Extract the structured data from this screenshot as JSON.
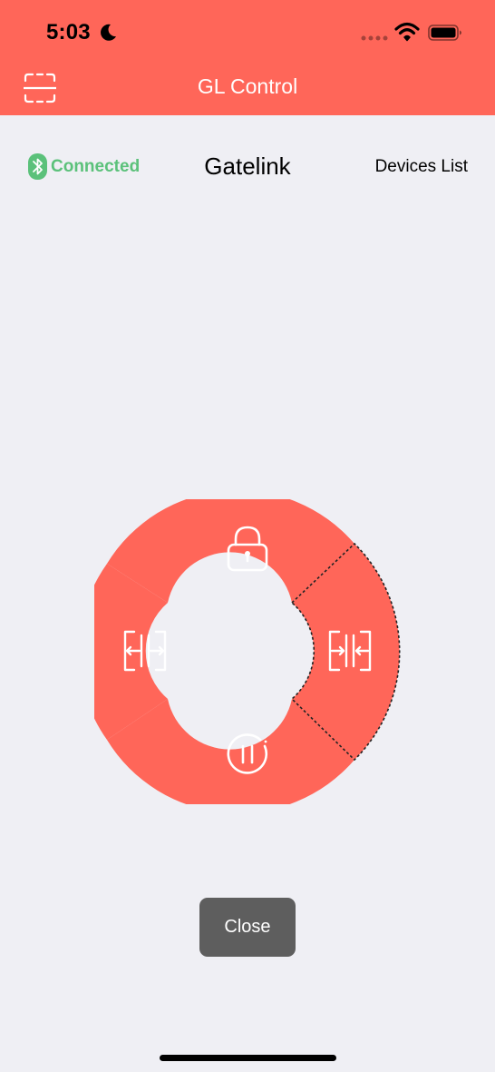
{
  "status_bar": {
    "time": "5:03",
    "icons": [
      "moon-icon",
      "signal-dots-icon",
      "wifi-icon",
      "battery-icon"
    ]
  },
  "header": {
    "title": "GL Control",
    "left_icon": "scan-icon"
  },
  "connection": {
    "icon": "bluetooth-icon",
    "status": "Connected",
    "device": "Gatelink",
    "devices_link": "Devices List"
  },
  "control_wheel": {
    "segments": [
      {
        "id": "lock",
        "icon": "lock-icon"
      },
      {
        "id": "open",
        "icon": "open-gate-icon"
      },
      {
        "id": "close",
        "icon": "close-gate-icon",
        "selected": true
      },
      {
        "id": "pause",
        "icon": "pause-icon"
      }
    ]
  },
  "close_button": "Close",
  "colors": {
    "accent": "#FF6659",
    "connected": "#5BC17A",
    "background": "#EFEFF4",
    "button": "#5E5E5E"
  }
}
